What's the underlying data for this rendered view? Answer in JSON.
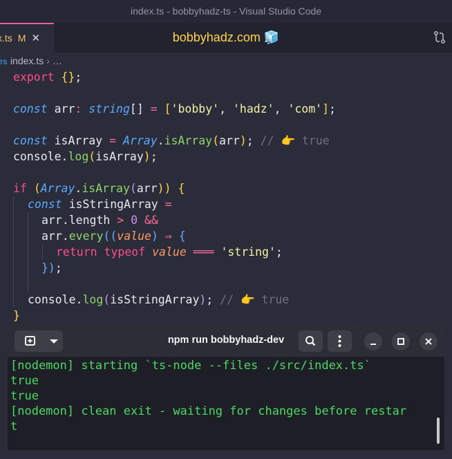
{
  "window_title": "index.ts - bobbyhadz-ts - Visual Studio Code",
  "tab": {
    "name": "x.ts",
    "modified": "M",
    "close": "✕"
  },
  "center_title": "bobbyhadz.com 🧊",
  "breadcrumb": {
    "icon": "TS",
    "file": "index.ts",
    "sep": "›",
    "more": "…"
  },
  "code": {
    "l1_export": "export",
    "l1_braces": "{}",
    "l1_semi": ";",
    "l3_const": "const",
    "l3_rest_a": " arr",
    "l3_colon": ":",
    "l3_type": "string",
    "l3_arr": "[]",
    "l3_eq": " = ",
    "l3_open": "[",
    "l3_s1": "'bobby'",
    "l3_c1": ", ",
    "l3_s2": "'hadz'",
    "l3_c2": ", ",
    "l3_s3": "'com'",
    "l3_close": "]",
    "l3_semi": ";",
    "l5_const": "const",
    "l5_name": " isArray ",
    "l5_eq": "=",
    "l5_cls": "Array",
    "l5_dot": ".",
    "l5_fn": "isArray",
    "l5_open": "(",
    "l5_arg": "arr",
    "l5_close": ")",
    "l5_semi": ";",
    "l5_cmt": "// 👉 true",
    "l6_obj": "console",
    "l6_dot": ".",
    "l6_fn": "log",
    "l6_open": "(",
    "l6_arg": "isArray",
    "l6_close": ")",
    "l6_semi": ";",
    "l8_if": "if",
    "l8_open": "(",
    "l8_cls": "Array",
    "l8_dot": ".",
    "l8_fn": "isArray",
    "l8_open2": "(",
    "l8_arg": "arr",
    "l8_close2": "))",
    "l8_brace": "{",
    "l9_const": "const",
    "l9_name": " isStringArray ",
    "l9_eq": "=",
    "l10_a": "arr",
    "l10_dot": ".",
    "l10_len": "length ",
    "l10_gt": ">",
    "l10_num": " 0 ",
    "l10_and": "&&",
    "l11_a": "arr",
    "l11_dot": ".",
    "l11_fn": "every",
    "l11_open": "((",
    "l11_prm": "value",
    "l11_close": ")",
    "l11_arrow": " ⇒ ",
    "l11_brace": "{",
    "l12_ret": "return",
    "l12_typeof": " typeof ",
    "l12_prm": "value",
    "l12_eq": " ═══ ",
    "l12_str": "'string'",
    "l12_semi": ";",
    "l13_close": "})",
    "l13_semi": ";",
    "l15_obj": "console",
    "l15_dot": ".",
    "l15_fn": "log",
    "l15_open": "(",
    "l15_arg": "isStringArray",
    "l15_close": ")",
    "l15_semi": ";",
    "l15_cmt": "// 👉 true",
    "l16_brace": "}"
  },
  "terminal": {
    "title": "npm run bobbyhadz-dev",
    "lines": [
      "[nodemon] starting `ts-node --files ./src/index.ts`",
      "true",
      "true",
      "[nodemon] clean exit - waiting for changes before restar",
      "t"
    ]
  },
  "icons": {
    "new_tab": "plus-in-square-icon",
    "dropdown": "chevron-down-icon",
    "search": "search-icon",
    "menu": "vertical-dots-icon",
    "minimize": "minimize-icon",
    "maximize": "maximize-icon",
    "close": "close-icon",
    "compare": "git-compare-icon"
  },
  "colors": {
    "accent_pink": "#ff5d9a",
    "terminal_green": "#4cd964",
    "title_yellow": "#ffd54a"
  }
}
